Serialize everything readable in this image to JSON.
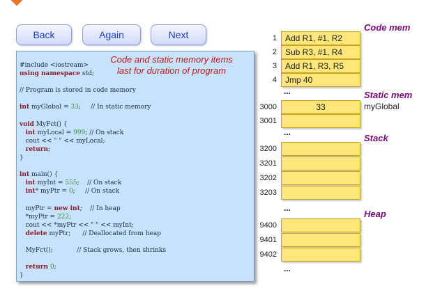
{
  "nav": {
    "back": "Back",
    "again": "Again",
    "next": "Next"
  },
  "note": {
    "line1": "Code and static memory items",
    "line2": "last for duration of program"
  },
  "code_lines": [
    [
      [
        "t",
        "#include <iostream>"
      ]
    ],
    [
      [
        "k",
        "using namespace"
      ],
      [
        "t",
        " std;"
      ]
    ],
    [
      [
        "t",
        ""
      ]
    ],
    [
      [
        "t",
        "// Program is stored in code memory"
      ]
    ],
    [
      [
        "t",
        ""
      ]
    ],
    [
      [
        "k",
        "int"
      ],
      [
        "t",
        " myGlobal = "
      ],
      [
        "n",
        "33"
      ],
      [
        "t",
        ";     // In static memory"
      ]
    ],
    [
      [
        "t",
        ""
      ]
    ],
    [
      [
        "k",
        "void"
      ],
      [
        "t",
        " MyFct() {"
      ]
    ],
    [
      [
        "t",
        "   "
      ],
      [
        "k",
        "int"
      ],
      [
        "t",
        " myLocal = "
      ],
      [
        "n",
        "999"
      ],
      [
        "t",
        "; // On stack"
      ]
    ],
    [
      [
        "t",
        "   cout << \" \" << myLocal;"
      ]
    ],
    [
      [
        "t",
        "   "
      ],
      [
        "k",
        "return"
      ],
      [
        "t",
        ";"
      ]
    ],
    [
      [
        "t",
        "}"
      ]
    ],
    [
      [
        "t",
        ""
      ]
    ],
    [
      [
        "k",
        "int"
      ],
      [
        "t",
        " main() {"
      ]
    ],
    [
      [
        "t",
        "   "
      ],
      [
        "k",
        "int"
      ],
      [
        "t",
        " myInt = "
      ],
      [
        "n",
        "555"
      ],
      [
        "t",
        ";    // On stack"
      ]
    ],
    [
      [
        "t",
        "   "
      ],
      [
        "k",
        "int"
      ],
      [
        "t",
        "* myPtr = "
      ],
      [
        "n",
        "0"
      ],
      [
        "t",
        ";     // On stack"
      ]
    ],
    [
      [
        "t",
        ""
      ]
    ],
    [
      [
        "t",
        "   myPtr = "
      ],
      [
        "k",
        "new int"
      ],
      [
        "t",
        ";    // In heap"
      ]
    ],
    [
      [
        "t",
        "   *myPtr = "
      ],
      [
        "n",
        "222"
      ],
      [
        "t",
        ";"
      ]
    ],
    [
      [
        "t",
        "   cout << *myPtr << \" \" << myInt;"
      ]
    ],
    [
      [
        "t",
        "   "
      ],
      [
        "k",
        "delete"
      ],
      [
        "t",
        " myPtr;      // Deallocated from heap"
      ]
    ],
    [
      [
        "t",
        ""
      ]
    ],
    [
      [
        "t",
        "   MyFct();            // Stack grows, then shrinks"
      ]
    ],
    [
      [
        "t",
        ""
      ]
    ],
    [
      [
        "t",
        "   "
      ],
      [
        "k",
        "return"
      ],
      [
        "t",
        " "
      ],
      [
        "n",
        "0"
      ],
      [
        "t",
        ";"
      ]
    ],
    [
      [
        "t",
        "}"
      ]
    ]
  ],
  "code_mem": {
    "title": "Code mem",
    "rows": [
      {
        "addr": "1",
        "value": "Add R1, #1, R2"
      },
      {
        "addr": "2",
        "value": "Sub R3, #1, R4"
      },
      {
        "addr": "3",
        "value": "Add R1, R3, R5"
      },
      {
        "addr": "4",
        "value": "Jmp 40"
      }
    ]
  },
  "static_mem": {
    "title": "Static mem",
    "rows": [
      {
        "addr": "3000",
        "value": "33",
        "name": "myGlobal"
      },
      {
        "addr": "3001",
        "value": "",
        "name": ""
      }
    ]
  },
  "stack": {
    "title": "Stack",
    "rows": [
      {
        "addr": "3200",
        "value": ""
      },
      {
        "addr": "3201",
        "value": ""
      },
      {
        "addr": "3202",
        "value": ""
      },
      {
        "addr": "3203",
        "value": ""
      }
    ]
  },
  "heap": {
    "title": "Heap",
    "rows": [
      {
        "addr": "9400",
        "value": ""
      },
      {
        "addr": "9401",
        "value": ""
      },
      {
        "addr": "9402",
        "value": ""
      }
    ]
  },
  "ellipsis": "...",
  "colors": {
    "cell_fill": "#fde77a",
    "panel_bg": "#c6e3fb",
    "title_purple": "#7b0b7b",
    "note_red": "#c4161c"
  }
}
